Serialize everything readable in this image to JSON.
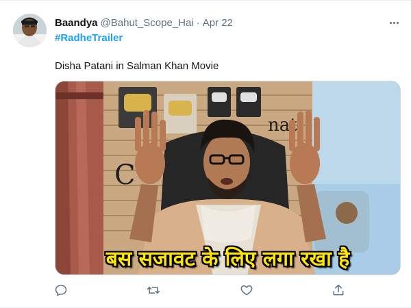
{
  "tweet": {
    "display_name": "Baandya",
    "handle": "@Bahut_Scope_Hai",
    "separator": "·",
    "date": "Apr 22",
    "hashtag": "#RadheTrailer",
    "text": "Disha Patani in Salman Khan Movie"
  },
  "media": {
    "subtitle": "बस सजावट के लिए लगा रखा है",
    "description_icon": "meme-video-frame"
  },
  "actions": {
    "reply_icon": "reply-icon",
    "retweet_icon": "retweet-icon",
    "like_icon": "heart-icon",
    "share_icon": "share-icon"
  },
  "colors": {
    "link": "#1da1f2",
    "secondary_text": "#5b7083",
    "subtitle": "#ffe600"
  }
}
